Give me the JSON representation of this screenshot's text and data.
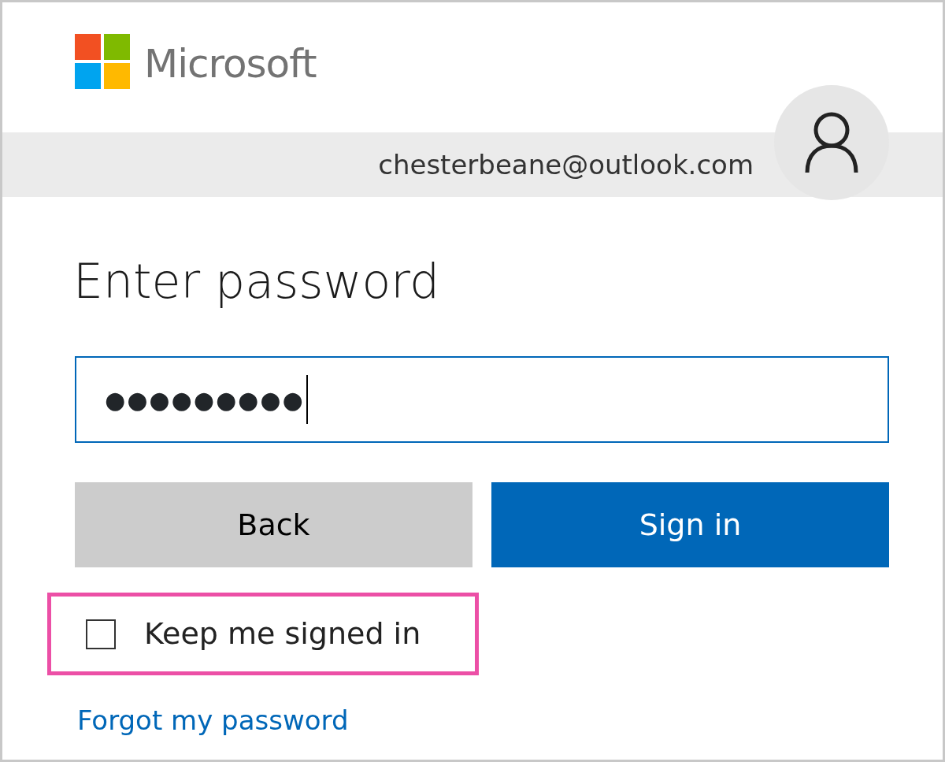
{
  "brand": {
    "name": "Microsoft"
  },
  "account": {
    "email": "chesterbeane@outlook.com"
  },
  "heading": "Enter password",
  "password_field": {
    "value": "●●●●●●●●●",
    "focused": true
  },
  "buttons": [
    {
      "label": "Back",
      "kind": "secondary"
    },
    {
      "label": "Sign in",
      "kind": "primary"
    }
  ],
  "keep_signed_in": {
    "label": "Keep me signed in",
    "checked": false,
    "highlighted": true
  },
  "forgot_link": "Forgot my password"
}
